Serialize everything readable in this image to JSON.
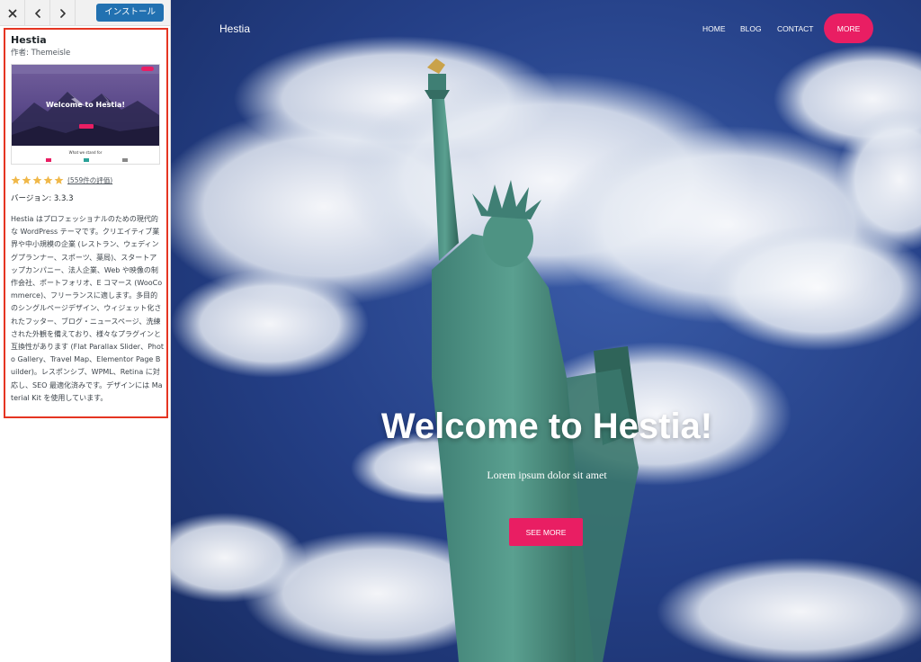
{
  "toolbar": {
    "close_icon": "close-icon",
    "prev_icon": "chevron-left-icon",
    "next_icon": "chevron-right-icon",
    "install_label": "インストール",
    "accent": "#2271b1"
  },
  "theme": {
    "name": "Hestia",
    "author": "作者: Themeisle",
    "thumbnail": {
      "title": "Welcome to Hestia!",
      "subtitle": "What we stand for"
    },
    "rating": {
      "stars": 5,
      "max": 5,
      "count_label": "(559件の評価)"
    },
    "version": "バージョン: 3.3.3",
    "description": "Hestia はプロフェッショナルのための現代的な WordPress テーマです。クリエイティブ業界や中小規模の企業 (レストラン、ウェディングプランナー、スポーツ、薬局)、スタートアップカンパニー、法人企業、Web や映像の制作会社、ポートフォリオ、E コマース (WooCommerce)、フリーランスに適します。多目的のシングルページデザイン、ウィジェット化されたフッター、ブログ・ニュースページ、洗練された外観を備えており、様々なプラグインと互換性があります (Flat Parallax Slider、Photo Gallery、Travel Map、Elementor Page Builder)。レスポンシブ、WPML、Retina に対応し、SEO 最適化済みです。デザインには Material Kit を使用しています。",
    "highlight_color": "#e53522",
    "star_color": "#f0b849"
  },
  "preview": {
    "brand": "Hestia",
    "nav": [
      "HOME",
      "BLOG",
      "CONTACT"
    ],
    "nav_button": "MORE",
    "hero_title": "Welcome to Hestia!",
    "hero_subtitle": "Lorem ipsum dolor sit amet",
    "hero_button": "SEE MORE",
    "accent": "#e91e63"
  }
}
